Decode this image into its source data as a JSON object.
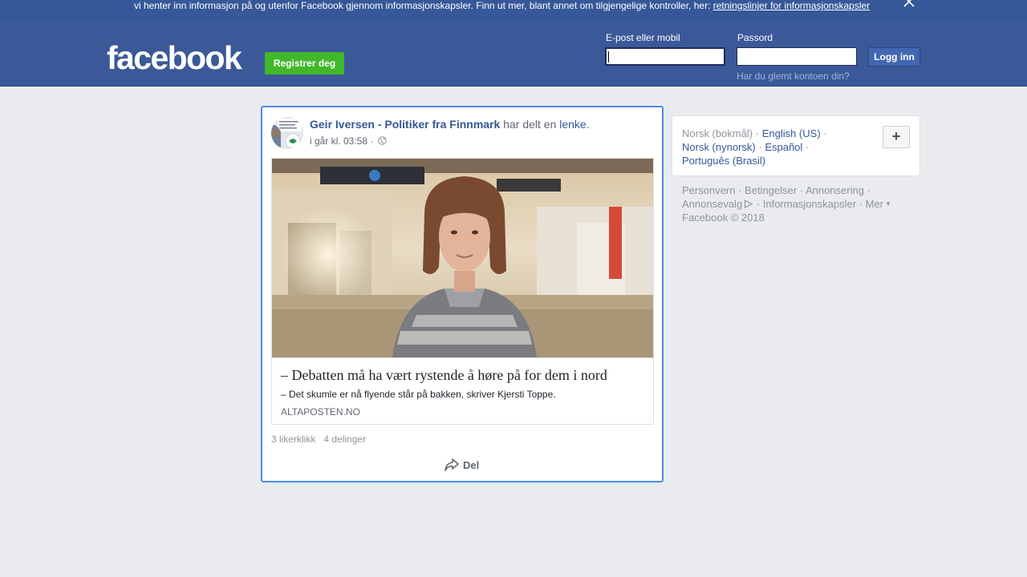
{
  "cookie_banner": {
    "text": "vi henter inn informasjon på og utenfor Facebook gjennom informasjonskapsler. Finn ut mer, blant annet om tilgjengelige kontroller, her: ",
    "link": "retningslinjer for informasjonskapsler"
  },
  "header": {
    "logo": "facebook",
    "register_button": "Registrer deg",
    "email_label": "E-post eller mobil",
    "password_label": "Passord",
    "email_value": "",
    "password_value": "",
    "login_button": "Logg inn",
    "forgot_link": "Har du glemt kontoen din?"
  },
  "post": {
    "author": "Geir Iversen - Politiker fra Finnmark",
    "action_text": " har delt en ",
    "action_link": "lenke",
    "action_end": ".",
    "timestamp": "i går kl. 03:58",
    "meta_separator": " · ",
    "privacy_icon": "globe-icon",
    "link_preview": {
      "title": "– Debatten må ha vært rystende å høre på for dem i nord",
      "description": "– Det skumle er nå flyende står på bakken, skriver Kjersti Toppe.",
      "domain": "ALTAPOSTEN.NO"
    },
    "likes": "3 likerklikk",
    "shares": "4 delinger",
    "share_button": "Del"
  },
  "languages": {
    "current": "Norsk (bokmål)",
    "sep": " · ",
    "items": [
      "English (US)",
      "Norsk (nynorsk)",
      "Español",
      "Português (Brasil)"
    ],
    "add_button": "+"
  },
  "footer": {
    "links": [
      "Personvern",
      "Betingelser",
      "Annonsering",
      "Annonsevalg",
      "Informasjonskapsler",
      "Mer"
    ],
    "sep": " · ",
    "copyright": "Facebook © 2018"
  },
  "colors": {
    "brand": "#3b5998",
    "cookie_bar": "#365899",
    "register_green": "#42b72a",
    "link_blue": "#365899",
    "post_highlight": "#4c8aea"
  }
}
